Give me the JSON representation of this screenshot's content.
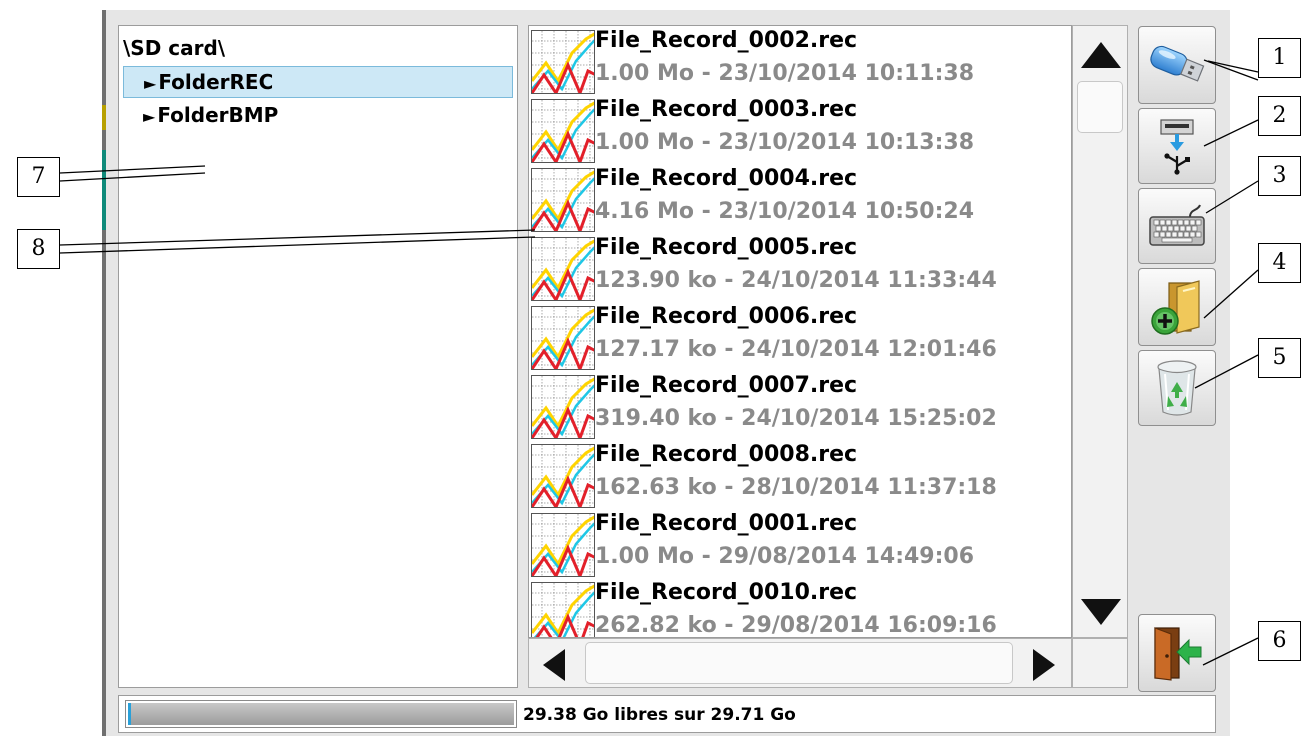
{
  "tree": {
    "root_label": "\\SD card\\",
    "items": [
      {
        "label": "FolderREC",
        "selected": true
      },
      {
        "label": "FolderBMP",
        "selected": false
      }
    ]
  },
  "files": [
    {
      "name": "File_Record_0002.rec",
      "info": "1.00 Mo - 23/10/2014 10:11:38"
    },
    {
      "name": "File_Record_0003.rec",
      "info": "1.00 Mo - 23/10/2014 10:13:38"
    },
    {
      "name": "File_Record_0004.rec",
      "info": "4.16 Mo - 23/10/2014 10:50:24"
    },
    {
      "name": "File_Record_0005.rec",
      "info": "123.90 ko - 24/10/2014 11:33:44"
    },
    {
      "name": "File_Record_0006.rec",
      "info": "127.17 ko - 24/10/2014 12:01:46"
    },
    {
      "name": "File_Record_0007.rec",
      "info": "319.40 ko - 24/10/2014 15:25:02"
    },
    {
      "name": "File_Record_0008.rec",
      "info": "162.63 ko - 28/10/2014 11:37:18"
    },
    {
      "name": "File_Record_0001.rec",
      "info": "1.00 Mo - 29/08/2014 14:49:06"
    },
    {
      "name": "File_Record_0010.rec",
      "info": "262.82 ko - 29/08/2014 16:09:16"
    }
  ],
  "status": {
    "free_space_text": "29.38 Go libres sur 29.71 Go",
    "used_fraction": 0.011
  },
  "side_buttons": [
    {
      "icon": "usb-stick-icon"
    },
    {
      "icon": "usb-transfer-icon"
    },
    {
      "icon": "keyboard-icon"
    },
    {
      "icon": "new-folder-icon"
    },
    {
      "icon": "recycle-bin-icon"
    },
    {
      "icon": "exit-door-icon"
    }
  ],
  "callouts": [
    "1",
    "2",
    "3",
    "4",
    "5",
    "6",
    "7",
    "8"
  ],
  "colors": {
    "selection_bg": "#cde8f6",
    "selection_border": "#7bbadb",
    "file_info_text": "#8a8a8a",
    "exit_arrow": "#2db34a",
    "recycle_green": "#3fae49"
  }
}
